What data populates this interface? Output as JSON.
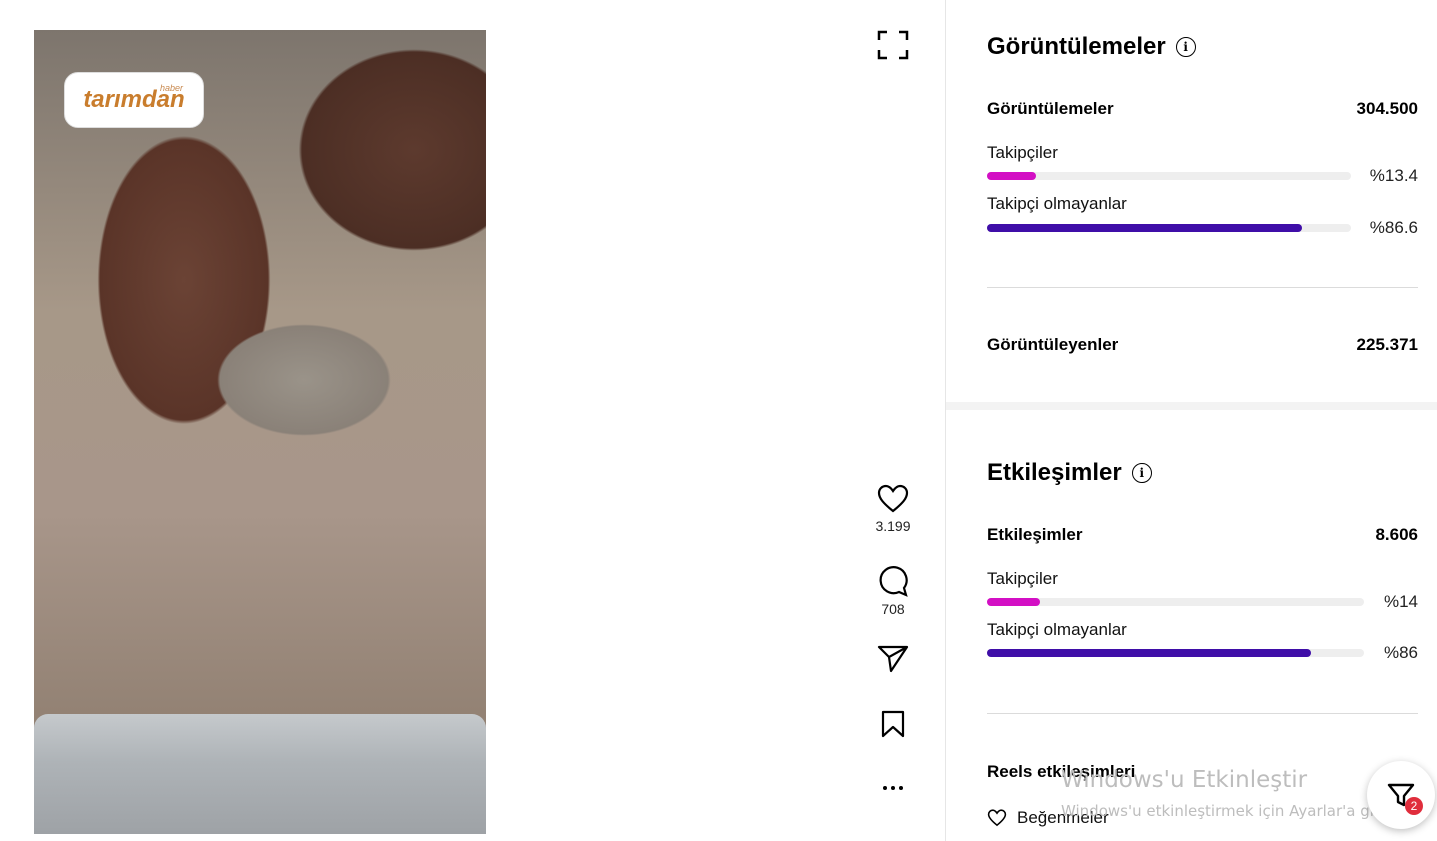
{
  "video": {
    "logo_brand": "tarımdan",
    "logo_small": "haber"
  },
  "actions": {
    "fullscreen_icon": "expand-icon",
    "like_count": "3.199",
    "comment_count": "708",
    "share_icon": "send-icon",
    "save_icon": "bookmark-icon",
    "more_icon": "more-icon"
  },
  "views_section": {
    "title": "Görüntülemeler",
    "total_label": "Görüntülemeler",
    "total_value": "304.500",
    "followers_label": "Takipçiler",
    "followers_pct": "%13.4",
    "followers_fraction": 0.134,
    "non_followers_label": "Takipçi olmayanlar",
    "non_followers_pct": "%86.6",
    "non_followers_fraction": 0.866,
    "viewers_label": "Görüntüleyenler",
    "viewers_value": "225.371"
  },
  "interactions_section": {
    "title": "Etkileşimler",
    "total_label": "Etkileşimler",
    "total_value": "8.606",
    "followers_label": "Takipçiler",
    "followers_pct": "%14",
    "followers_fraction": 0.14,
    "non_followers_label": "Takipçi olmayanlar",
    "non_followers_pct": "%86",
    "non_followers_fraction": 0.86,
    "reels_label": "Reels etkileşimleri",
    "likes_label": "Beğenmeler"
  },
  "colors": {
    "followers": "#d30fc4",
    "non_followers": "#3f0ea8"
  },
  "overlay": {
    "watermark_title": "Windows'u Etkinleştir",
    "watermark_sub": "Windows'u etkinleştirmek için Ayarlar'a gidin.",
    "filter_badge": "2"
  }
}
